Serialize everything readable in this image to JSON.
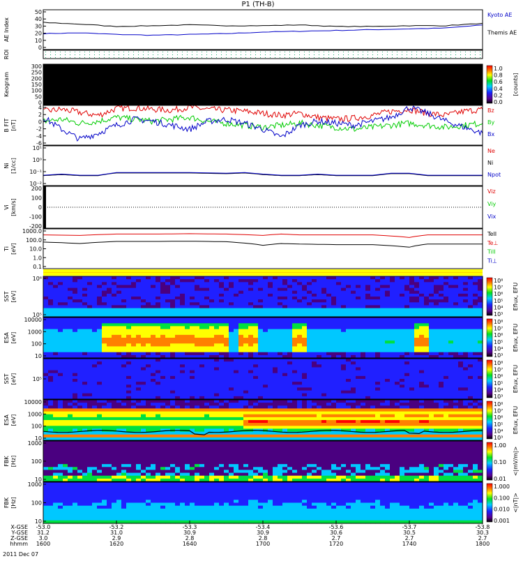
{
  "title": "P1 (TH-B)",
  "date_label": "2011 Dec 07",
  "axis_rows": {
    "labels": [
      "X-GSE",
      "Y-GSE",
      "Z-GSE",
      "hhmm"
    ],
    "values": [
      [
        "-53.0",
        "-53.2",
        "-53.3",
        "-53.4",
        "-53.6",
        "-53.7",
        "-53.8"
      ],
      [
        "31.2",
        "31.0",
        "30.9",
        "30.9",
        "30.6",
        "30.5",
        "30.3"
      ],
      [
        "3.0",
        "2.9",
        "2.8",
        "2.8",
        "2.7",
        "2.7",
        "2.7"
      ],
      [
        "1600",
        "1620",
        "1640",
        "1700",
        "1720",
        "1740",
        "1800"
      ]
    ]
  },
  "colors": {
    "bx": "#0000c8",
    "by": "#00cc00",
    "bz": "#e00000",
    "black": "#000000"
  },
  "chart_data": [
    {
      "id": "ae",
      "type": "line",
      "ylabel": "AE Index",
      "ylim": [
        0,
        50
      ],
      "yticks": [
        "0",
        "10",
        "20",
        "30",
        "40",
        "50"
      ],
      "legend": [
        {
          "name": "Kyoto AE",
          "color": "#0000c8"
        },
        {
          "name": "Themis AE",
          "color": "#000000"
        }
      ],
      "series": [
        {
          "name": "Kyoto AE",
          "x": [
            1600,
            1610,
            1620,
            1630,
            1640,
            1650,
            1700,
            1710,
            1720,
            1730,
            1740,
            1750,
            1800
          ],
          "values": [
            20,
            21,
            19,
            18,
            19,
            20,
            22,
            23,
            24,
            25,
            26,
            27,
            31
          ]
        },
        {
          "name": "Themis AE",
          "x": [
            1600,
            1610,
            1620,
            1630,
            1640,
            1650,
            1700,
            1710,
            1720,
            1730,
            1740,
            1750,
            1800
          ],
          "values": [
            34,
            32,
            29,
            30,
            31,
            30,
            30,
            31,
            29,
            29,
            30,
            30,
            33
          ]
        }
      ]
    },
    {
      "id": "roi",
      "type": "heatmap",
      "ylabel": "ROI",
      "yticks": []
    },
    {
      "id": "keogram",
      "type": "heatmap",
      "ylabel": "Keogram",
      "ylim": [
        0,
        300
      ],
      "yticks": [
        "0",
        "50",
        "100",
        "150",
        "200",
        "250",
        "300"
      ],
      "colorbar": {
        "label": "[counts]",
        "ticks": [
          "0.0",
          "0.2",
          "0.4",
          "0.6",
          "0.8",
          "1.0"
        ]
      }
    },
    {
      "id": "bfield",
      "type": "line",
      "ylabel": "B FIT",
      "yunit": "[nT]",
      "ylim": [
        -6,
        4
      ],
      "yticks": [
        "-6",
        "-4",
        "-2",
        "0",
        "2",
        "4"
      ],
      "legend": [
        {
          "name": "Bz",
          "color": "#e00000"
        },
        {
          "name": "By",
          "color": "#00cc00"
        },
        {
          "name": "Bx",
          "color": "#0000c8"
        }
      ],
      "series": [
        {
          "name": "Bz",
          "x": [
            1600,
            1605,
            1610,
            1615,
            1620,
            1625,
            1630,
            1635,
            1640,
            1645,
            1650,
            1655,
            1700,
            1705,
            1710,
            1715,
            1720,
            1725,
            1730,
            1735,
            1740,
            1745,
            1750,
            1755,
            1800
          ],
          "values": [
            2.5,
            3.0,
            2.2,
            1.5,
            3.2,
            3.4,
            3.0,
            2.8,
            3.5,
            3.0,
            2.8,
            2.5,
            2.0,
            1.5,
            2.0,
            1.0,
            0.5,
            0.8,
            1.5,
            2.5,
            3.0,
            2.0,
            1.5,
            2.5,
            3.0
          ]
        },
        {
          "name": "By",
          "x": [
            1600,
            1605,
            1610,
            1615,
            1620,
            1625,
            1630,
            1635,
            1640,
            1645,
            1650,
            1655,
            1700,
            1705,
            1710,
            1715,
            1720,
            1725,
            1730,
            1735,
            1740,
            1745,
            1750,
            1755,
            1800
          ],
          "values": [
            0.0,
            0.5,
            -0.5,
            0.0,
            1.0,
            0.5,
            0.0,
            0.5,
            1.0,
            0.0,
            -0.5,
            -1.0,
            -1.5,
            -1.0,
            -0.5,
            -1.0,
            -1.5,
            -2.0,
            -1.5,
            -1.0,
            -0.5,
            -1.0,
            -1.5,
            -1.0,
            -0.5
          ]
        },
        {
          "name": "Bx",
          "x": [
            1600,
            1605,
            1610,
            1615,
            1620,
            1625,
            1630,
            1635,
            1640,
            1645,
            1650,
            1655,
            1700,
            1705,
            1710,
            1715,
            1720,
            1725,
            1730,
            1735,
            1740,
            1745,
            1750,
            1755,
            1800
          ],
          "values": [
            1.0,
            -2.0,
            -4.5,
            -3.0,
            -1.0,
            0.5,
            0.0,
            -1.0,
            -2.0,
            0.0,
            0.5,
            -0.5,
            -2.0,
            -4.0,
            -1.0,
            0.0,
            -0.5,
            -1.0,
            0.0,
            1.0,
            3.5,
            2.0,
            0.0,
            -1.5,
            -3.0
          ]
        }
      ]
    },
    {
      "id": "density",
      "type": "line",
      "ylabel": "Ni",
      "yunit": "[1/cc]",
      "ylog": true,
      "yticks": [
        "10⁻²",
        "10⁻¹",
        "10⁰",
        "10¹"
      ],
      "legend": [
        {
          "name": "Ne",
          "color": "#e00000"
        },
        {
          "name": "Ni",
          "color": "#000000"
        },
        {
          "name": "Npot",
          "color": "#0000c8"
        }
      ],
      "series": [
        {
          "name": "Ni",
          "x": [
            1600,
            1605,
            1610,
            1615,
            1620,
            1630,
            1640,
            1650,
            1655,
            1700,
            1705,
            1710,
            1715,
            1720,
            1725,
            1730,
            1735,
            1740,
            1745,
            1750,
            1755,
            1800
          ],
          "values": [
            0.04,
            0.05,
            0.04,
            0.04,
            0.07,
            0.07,
            0.07,
            0.06,
            0.07,
            0.05,
            0.04,
            0.04,
            0.05,
            0.04,
            0.04,
            0.04,
            0.06,
            0.06,
            0.04,
            0.04,
            0.04,
            0.04
          ]
        }
      ]
    },
    {
      "id": "velocity",
      "type": "line",
      "ylabel": "Vi",
      "yunit": "[km/s]",
      "ylim": [
        -300,
        300
      ],
      "yticks": [
        "-200",
        "-100",
        "0",
        "100",
        "200"
      ],
      "legend": [
        {
          "name": "Viz",
          "color": "#e00000"
        },
        {
          "name": "Viy",
          "color": "#00cc00"
        },
        {
          "name": "Vix",
          "color": "#0000c8"
        }
      ],
      "series": []
    },
    {
      "id": "temperature",
      "type": "line",
      "ylabel": "Ti",
      "yunit": "[eV]",
      "ylog": true,
      "yticks": [
        "0.1",
        "1.0",
        "10.0",
        "100.0",
        "1000.0"
      ],
      "legend": [
        {
          "name": "TeII",
          "color": "#000000"
        },
        {
          "name": "Te⊥",
          "color": "#e00000"
        },
        {
          "name": "TiII",
          "color": "#00cc00"
        },
        {
          "name": "Ti⊥",
          "color": "#0000c8"
        }
      ],
      "series": [
        {
          "name": "Te⊥",
          "x": [
            1600,
            1610,
            1620,
            1630,
            1640,
            1650,
            1700,
            1705,
            1710,
            1720,
            1730,
            1740,
            1745,
            1750,
            1800
          ],
          "values": [
            400,
            350,
            500,
            500,
            550,
            500,
            350,
            500,
            400,
            400,
            400,
            200,
            400,
            400,
            400
          ]
        },
        {
          "name": "TeII",
          "x": [
            1600,
            1610,
            1620,
            1630,
            1640,
            1650,
            1700,
            1705,
            1710,
            1720,
            1730,
            1740,
            1745,
            1750,
            1800
          ],
          "values": [
            60,
            40,
            70,
            70,
            75,
            65,
            25,
            40,
            35,
            30,
            30,
            15,
            35,
            35,
            35
          ]
        }
      ]
    },
    {
      "id": "status",
      "type": "heatmap",
      "ylabel": "",
      "yticks": []
    },
    {
      "id": "sst_ion",
      "type": "heatmap",
      "ylabel": "SST",
      "yunit": "[eV]",
      "yticks": [
        "10⁵",
        "10⁶"
      ],
      "colorbar": {
        "label": "Eflux, EFU",
        "ticks": [
          "10³",
          "10⁴",
          "10⁵",
          "10⁶",
          "10⁷",
          "10⁸"
        ]
      }
    },
    {
      "id": "esa_ion",
      "type": "heatmap",
      "ylabel": "ESA",
      "yunit": "[eV]",
      "yticks": [
        "10",
        "100",
        "1000",
        "10000"
      ],
      "colorbar": {
        "label": "Eflux, EFU",
        "ticks": [
          "10³",
          "10⁴",
          "10⁵",
          "10⁶",
          "10⁷",
          "10⁸"
        ]
      }
    },
    {
      "id": "sst_elec",
      "type": "heatmap",
      "ylabel": "SST",
      "yunit": "[eV]",
      "yticks": [
        "10⁵"
      ],
      "colorbar": {
        "label": "Eflux, EFU",
        "ticks": [
          "10³",
          "10⁴",
          "10⁵",
          "10⁶",
          "10⁷",
          "10⁸"
        ]
      }
    },
    {
      "id": "esa_elec",
      "type": "heatmap",
      "ylabel": "ESA",
      "yunit": "[eV]",
      "yticks": [
        "10",
        "100",
        "1000",
        "10000"
      ],
      "colorbar": {
        "label": "Eflux, EFU",
        "ticks": [
          "10³",
          "10⁴",
          "10⁵",
          "10⁶",
          "10⁷",
          "10⁸"
        ]
      }
    },
    {
      "id": "fbk_e",
      "type": "heatmap",
      "ylabel": "FBK",
      "yunit": "[Hz]",
      "yticks": [
        "10",
        "100",
        "1000"
      ],
      "colorbar": {
        "label": "<|mV/m|>",
        "ticks": [
          "0.01",
          "0.10",
          "1.00"
        ]
      }
    },
    {
      "id": "fbk_b",
      "type": "heatmap",
      "ylabel": "FBK",
      "yunit": "[Hz]",
      "yticks": [
        "10",
        "100",
        "1000"
      ],
      "colorbar": {
        "label": "<|nT|>",
        "ticks": [
          "0.001",
          "0.010",
          "0.100",
          "1.000"
        ]
      }
    }
  ]
}
